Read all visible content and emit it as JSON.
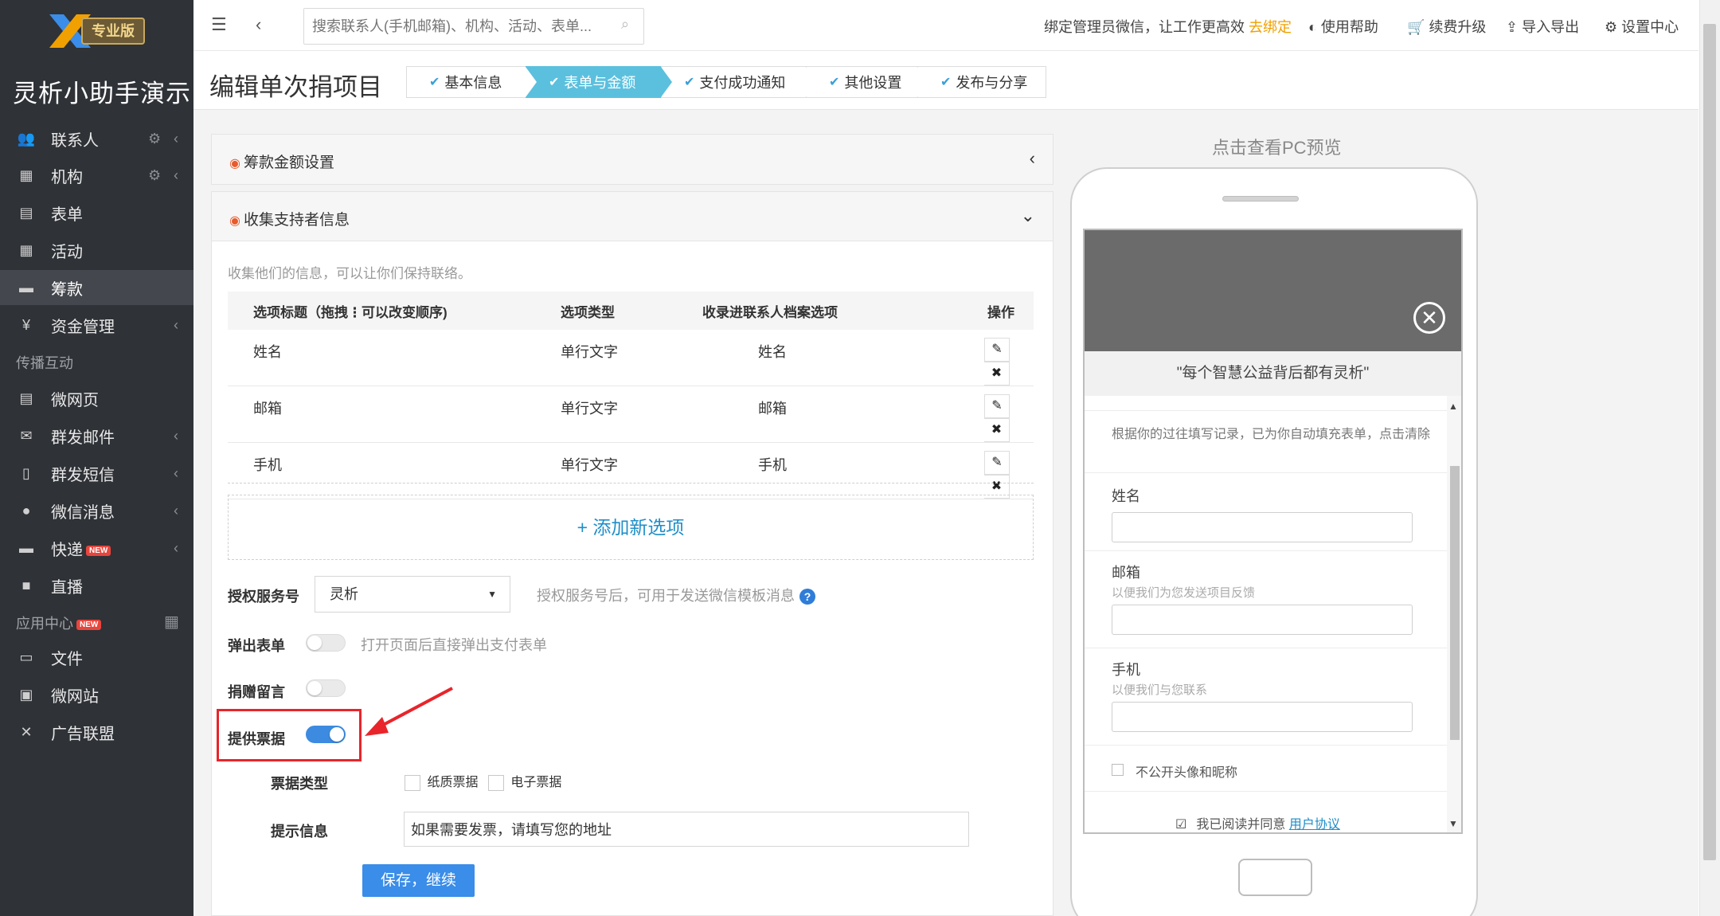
{
  "sidebar": {
    "logo_badge": "专业版",
    "app_title": "灵析小助手演示",
    "items": [
      {
        "label": "联系人",
        "icon": "contacts-icon",
        "glyph": "👥"
      },
      {
        "label": "机构",
        "icon": "building-icon",
        "glyph": "▦"
      },
      {
        "label": "表单",
        "icon": "form-icon",
        "glyph": "▤"
      },
      {
        "label": "活动",
        "icon": "calendar-icon",
        "glyph": "▦"
      },
      {
        "label": "筹款",
        "icon": "fundraise-icon",
        "glyph": "▬"
      },
      {
        "label": "资金管理",
        "icon": "yen-icon",
        "glyph": "¥"
      }
    ],
    "group_spread": "传播互动",
    "spread_items": [
      {
        "label": "微网页",
        "icon": "page-icon",
        "glyph": "▤"
      },
      {
        "label": "群发邮件",
        "icon": "mail-icon",
        "glyph": "✉"
      },
      {
        "label": "群发短信",
        "icon": "phone-icon",
        "glyph": "▯"
      },
      {
        "label": "微信消息",
        "icon": "wechat-icon",
        "glyph": "●"
      },
      {
        "label": "快递",
        "icon": "truck-icon",
        "glyph": "▬"
      },
      {
        "label": "直播",
        "icon": "video-icon",
        "glyph": "■"
      }
    ],
    "new_badge": "NEW",
    "group_apps": "应用中心",
    "app_items": [
      {
        "label": "文件",
        "icon": "folder-icon",
        "glyph": "▭"
      },
      {
        "label": "微网站",
        "icon": "site-icon",
        "glyph": "▣"
      },
      {
        "label": "广告联盟",
        "icon": "ad-icon",
        "glyph": "✕"
      }
    ]
  },
  "topbar": {
    "search_placeholder": "搜索联系人(手机邮箱)、机构、活动、表单...",
    "bind_text": "绑定管理员微信，让工作更高效",
    "bind_link": "去绑定",
    "help": "使用帮助",
    "upgrade": "续费升级",
    "import_export": "导入导出",
    "settings": "设置中心"
  },
  "page": {
    "title": "编辑单次捐项目",
    "steps": [
      "基本信息",
      "表单与金额",
      "支付成功通知",
      "其他设置",
      "发布与分享"
    ],
    "active_step": 1
  },
  "panel_amount": {
    "title": "筹款金额设置"
  },
  "panel_collect": {
    "title": "收集支持者信息",
    "hint": "收集他们的信息，可以让你们保持联络。",
    "columns": [
      "选项标题（拖拽⋮可以改变顺序)",
      "选项类型",
      "收录进联系人档案选项",
      "操作"
    ],
    "rows": [
      {
        "title": "姓名",
        "type": "单行文字",
        "field": "姓名"
      },
      {
        "title": "邮箱",
        "type": "单行文字",
        "field": "邮箱"
      },
      {
        "title": "手机",
        "type": "单行文字",
        "field": "手机"
      }
    ],
    "add_option": "+ 添加新选项",
    "auth_label": "授权服务号",
    "auth_value": "灵析",
    "auth_help": "授权服务号后，可用于发送微信模板消息",
    "popup_label": "弹出表单",
    "popup_help": "打开页面后直接弹出支付表单",
    "popup_on": false,
    "message_label": "捐赠留言",
    "message_on": false,
    "invoice_label": "提供票据",
    "invoice_on": true,
    "invoice_type_label": "票据类型",
    "invoice_types": [
      "纸质票据",
      "电子票据"
    ],
    "tip_label": "提示信息",
    "tip_value": "如果需要发票，请填写您的地址",
    "save_button": "保存，继续"
  },
  "preview": {
    "link": "点击查看PC预览",
    "quote": "\"每个智慧公益背后都有灵析\"",
    "autofill_note": "根据你的过往填写记录，已为你自动填充表单，点击清除",
    "fields": [
      {
        "label": "姓名",
        "sub": ""
      },
      {
        "label": "邮箱",
        "sub": "以便我们为您发送项目反馈"
      },
      {
        "label": "手机",
        "sub": "以便我们与您联系"
      }
    ],
    "anonymous": "不公开头像和昵称",
    "agree_prefix": "我已阅读并同意",
    "agree_link": "用户协议"
  },
  "colors": {
    "sidebar_bg": "#2f3237",
    "accent_blue": "#3a8de8",
    "step_active": "#5bc0de",
    "annotation_red": "#e8252b",
    "bind_orange": "#f0a000"
  }
}
